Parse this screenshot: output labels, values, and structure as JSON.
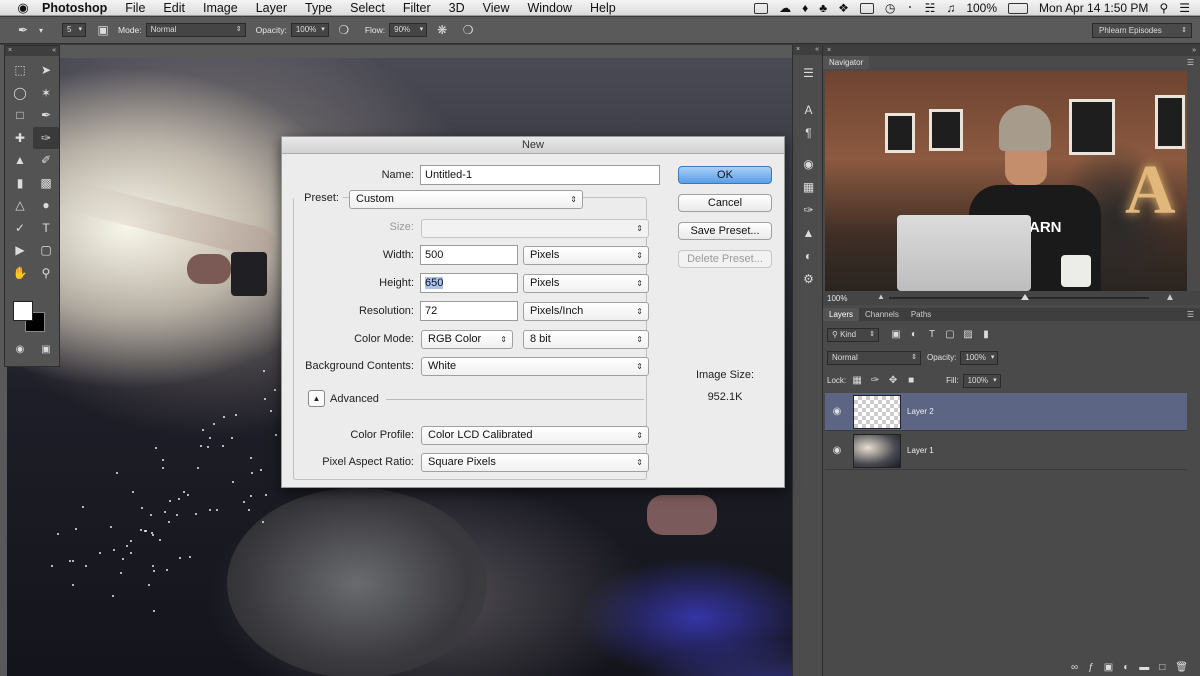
{
  "menubar": {
    "apple": "",
    "app_name": "Photoshop",
    "items": [
      "File",
      "Edit",
      "Image",
      "Layer",
      "Type",
      "Select",
      "Filter",
      "3D",
      "View",
      "Window",
      "Help"
    ],
    "battery": "100%",
    "clock": "Mon Apr 14  1:50 PM"
  },
  "options_bar": {
    "brush_size": "5",
    "mode_label": "Mode:",
    "mode_value": "Normal",
    "opacity_label": "Opacity:",
    "opacity_value": "100%",
    "flow_label": "Flow:",
    "flow_value": "90%",
    "workspace": "Phlearn Episodes"
  },
  "dialog": {
    "title": "New",
    "name_label": "Name:",
    "name_value": "Untitled-1",
    "preset_label": "Preset:",
    "preset_value": "Custom",
    "size_label": "Size:",
    "size_value": "",
    "width_label": "Width:",
    "width_value": "500",
    "width_unit": "Pixels",
    "height_label": "Height:",
    "height_value": "650",
    "height_unit": "Pixels",
    "resolution_label": "Resolution:",
    "resolution_value": "72",
    "resolution_unit": "Pixels/Inch",
    "color_mode_label": "Color Mode:",
    "color_mode_value": "RGB Color",
    "bit_depth": "8 bit",
    "background_label": "Background Contents:",
    "background_value": "White",
    "advanced_label": "Advanced",
    "color_profile_label": "Color Profile:",
    "color_profile_value": "Color LCD Calibrated",
    "pixel_aspect_label": "Pixel Aspect Ratio:",
    "pixel_aspect_value": "Square Pixels",
    "ok": "OK",
    "cancel": "Cancel",
    "save_preset": "Save Preset...",
    "delete_preset": "Delete Preset...",
    "image_size_label": "Image Size:",
    "image_size_value": "952.1K"
  },
  "navigator": {
    "tab": "Navigator",
    "zoom": "100%",
    "thumb_text": "PHLEARN",
    "thumb_letter": "A"
  },
  "layers_panel": {
    "tabs": [
      "Layers",
      "Channels",
      "Paths"
    ],
    "kind_filter": "Kind",
    "blend_mode": "Normal",
    "opacity_label": "Opacity:",
    "opacity_value": "100%",
    "lock_label": "Lock:",
    "fill_label": "Fill:",
    "fill_value": "100%",
    "layers": [
      {
        "name": "Layer 2",
        "selected": true
      },
      {
        "name": "Layer 1",
        "selected": false
      }
    ]
  },
  "colors": {
    "selection_blue": "#5c6684",
    "ok_button": "#5a9ee8",
    "panel_bg": "#4a4a4a"
  }
}
